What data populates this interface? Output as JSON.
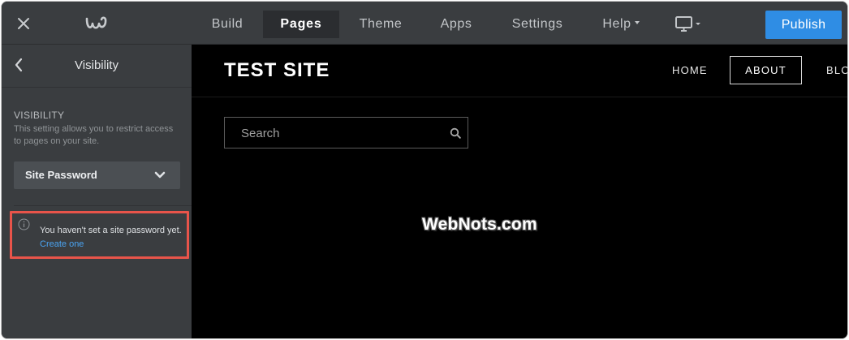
{
  "topbar": {
    "close_icon": "close-icon",
    "logo_icon": "weebly-logo-icon",
    "nav": [
      {
        "label": "Build"
      },
      {
        "label": "Pages",
        "active": true
      },
      {
        "label": "Theme"
      },
      {
        "label": "Apps"
      },
      {
        "label": "Settings"
      },
      {
        "label": "Help",
        "has_dropdown": true
      }
    ],
    "device_icon": "desktop-monitor-icon",
    "publish_label": "Publish",
    "accent": "#2f8de4"
  },
  "sidebar": {
    "title": "Visibility",
    "section_label": "VISIBILITY",
    "description": "This setting allows you to restrict access to pages on your site.",
    "select_value": "Site Password",
    "notice_text": "You haven't set a site password yet.",
    "notice_link": "Create one",
    "highlight_color": "#e8544a"
  },
  "site": {
    "title": "TEST SITE",
    "nav": {
      "home": "HOME",
      "about": "ABOUT",
      "blog": "BLO"
    },
    "search_placeholder": "Search",
    "watermark": "WebNots.com"
  }
}
